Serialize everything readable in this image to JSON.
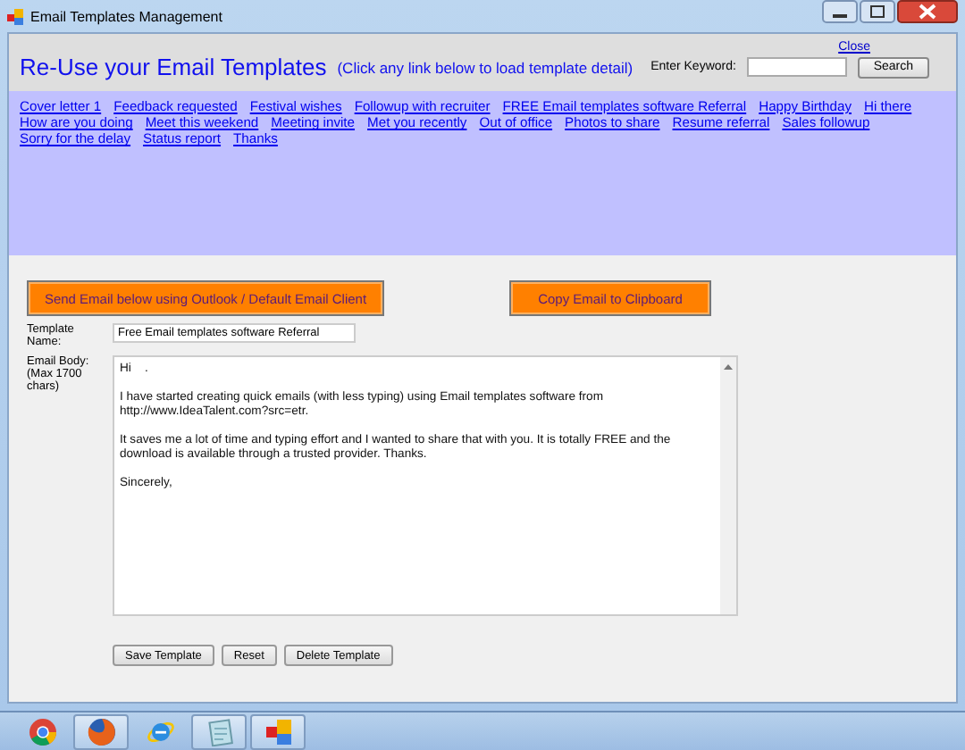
{
  "window": {
    "title": "Email Templates Management"
  },
  "header": {
    "close_link": "Close",
    "title": "Re-Use your Email Templates",
    "hint": "(Click any link below to load template detail)",
    "keyword_label": "Enter Keyword:",
    "search_button": "Search"
  },
  "template_links": [
    "Cover letter 1",
    "Feedback requested",
    "Festival wishes",
    "Followup with recruiter",
    "FREE Email templates software Referral",
    "Happy Birthday",
    "Hi there",
    "How are you doing",
    "Meet this weekend",
    "Meeting invite",
    "Met you recently",
    "Out of office",
    "Photos to share",
    "Resume referral",
    "Sales followup",
    "Sorry for the delay",
    "Status report",
    "Thanks"
  ],
  "actions": [
    "Send Email below using Outlook / Default Email Client",
    "Copy Email to Clipboard"
  ],
  "form": {
    "name_label": "Template Name:",
    "name_value": "Free Email templates software Referral",
    "body_label": "Email Body:",
    "body_hint": "(Max 1700 chars)",
    "body_paragraphs": [
      "Hi    .",
      "I have started creating quick emails (with less typing) using Email templates software from http://www.IdeaTalent.com?src=etr.",
      "It saves me a lot of time and typing effort and I wanted to share that with you. It is totally FREE and the download is available through a trusted provider. Thanks.",
      "Sincerely,"
    ]
  },
  "buttons": [
    "Save Template",
    "Reset",
    "Delete Template"
  ],
  "taskbar": [
    {
      "kind": "chrome",
      "running": false
    },
    {
      "kind": "firefox",
      "running": true
    },
    {
      "kind": "ie",
      "running": false
    },
    {
      "kind": "notepad",
      "running": true
    },
    {
      "kind": "app",
      "running": true
    }
  ]
}
